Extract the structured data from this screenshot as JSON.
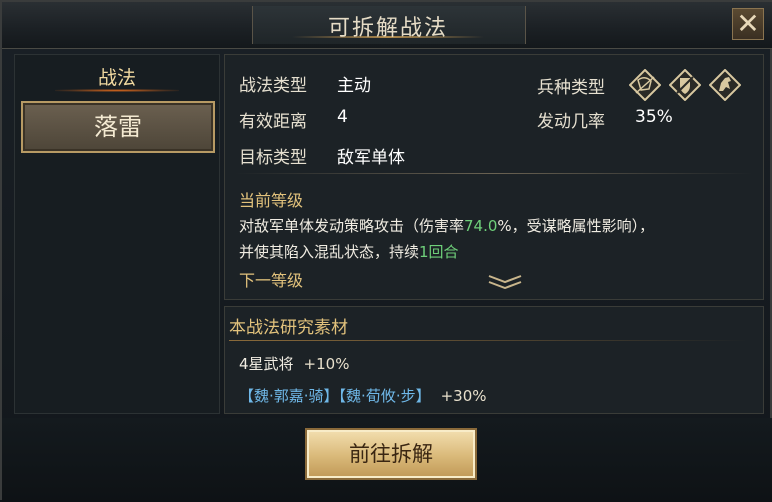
{
  "dialog": {
    "title": "可拆解战法",
    "close_label": "✕"
  },
  "left": {
    "tab_label": "战法",
    "selected_tactic": "落雷"
  },
  "info": {
    "type_label": "战法类型",
    "type_value": "主动",
    "range_label": "有效距离",
    "range_value": "4",
    "target_label": "目标类型",
    "target_value": "敌军单体",
    "troop_label": "兵种类型",
    "trigger_label": "发动几率",
    "trigger_value": "35%",
    "troop_icons": [
      "cavalry-crossed-icon",
      "shield-icon",
      "horse-icon"
    ]
  },
  "level": {
    "current_label": "当前等级",
    "desc_line1_a": "对敌军单体发动策略攻击（伤害率",
    "desc_line1_pct": "74.0",
    "desc_line1_b": "%，受谋略属性影响），",
    "desc_line2_a": "并使其陷入混乱状态，持续",
    "desc_line2_num": "1回合",
    "next_label": "下一等级"
  },
  "materials": {
    "title": "本战法研究素材",
    "row1_label": "4星武将",
    "row1_bonus": "+10%",
    "chip1": "【魏·郭嘉·骑】",
    "chip2": "【魏·荀攸·步】",
    "row2_bonus": "+30%"
  },
  "action": {
    "button_label": "前往拆解"
  },
  "colors": {
    "accent_gold": "#e2c27c",
    "highlight_green": "#6fd07a",
    "chip_blue": "#6fb8e8"
  }
}
